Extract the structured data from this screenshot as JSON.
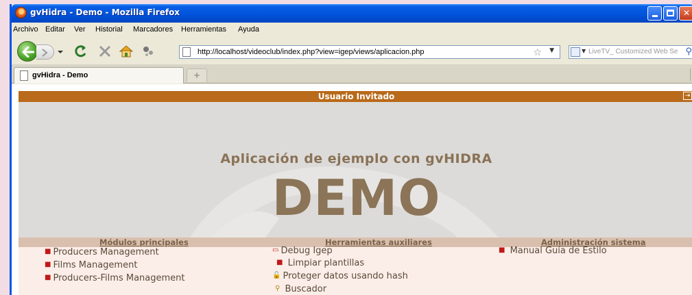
{
  "window": {
    "title": "gvHidra - Demo - Mozilla Firefox"
  },
  "menu": [
    "Archivo",
    "Editar",
    "Ver",
    "Historial",
    "Marcadores",
    "Herramientas",
    "Ayuda"
  ],
  "nav": {
    "url": "http://localhost/videoclub/index.php?view=igep/views/aplicacion.php",
    "search_placeholder": "LiveTV_ Customized Web Se"
  },
  "tabs": [
    {
      "label": "gvHidra - Demo"
    }
  ],
  "page": {
    "user_bar": "Usuario Invitado",
    "hero_subtitle": "Aplicación de ejemplo con gvHIDRA",
    "hero_title": "DEMO",
    "sections": [
      {
        "heading": "Módulos principales",
        "links": [
          "Producers Management",
          "Films Management",
          "Producers-Films Management"
        ]
      },
      {
        "heading": "Herramientas auxiliares",
        "links": [
          "Debug Igep",
          "Limpiar plantillas",
          "Proteger datos usando hash",
          "Buscador"
        ]
      },
      {
        "heading": "Administración sistema",
        "links": [
          "Manual Guía de Estilo"
        ]
      }
    ]
  },
  "colors": {
    "user_bar": "#b96a1a",
    "hero_bg": "#dcdbd9",
    "hero_text": "#8b7457",
    "section_head_bg": "#d9bfae",
    "links_bg": "#fbeee8"
  }
}
